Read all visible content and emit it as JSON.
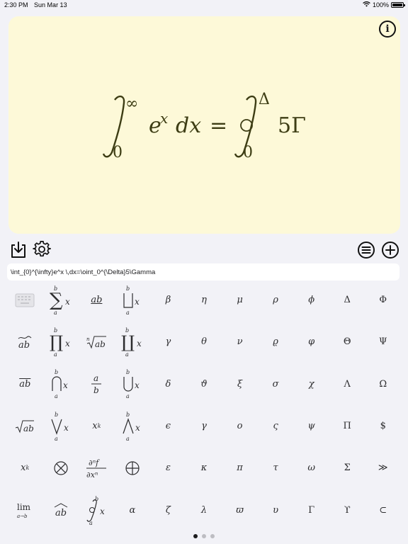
{
  "status_bar": {
    "time": "2:30 PM",
    "date": "Sun Mar 13",
    "battery": "100%"
  },
  "preview": {
    "info_glyph": "i",
    "formula": {
      "lower1": "0",
      "upper1": "∞",
      "body1": "e",
      "body1_exp": "x",
      "dx": "dx",
      "equals": "=",
      "lower2": "0",
      "upper2": "Δ",
      "rhs": "5Γ"
    }
  },
  "toolbar": {
    "icons": [
      "download-icon",
      "gear-icon",
      "list-icon",
      "add-icon"
    ]
  },
  "latex_input": {
    "value": "\\int_{0}^{\\infty}e^x \\,dx=\\oint_0^{\\Delta}5\\Gamma"
  },
  "keys": {
    "r1": [
      "keyboard-icon",
      "sum",
      "ab-underline",
      "coproduct",
      "β",
      "η",
      "μ",
      "ρ",
      "ϕ",
      "Δ",
      "Φ"
    ],
    "r2": [
      "ab-tilde",
      "product",
      "nth-root",
      "coproduct-big",
      "γ",
      "θ",
      "ν",
      "ϱ",
      "φ",
      "Θ",
      "Ψ"
    ],
    "r3": [
      "ab-overline",
      "bigcap",
      "fraction",
      "bigcup",
      "δ",
      "ϑ",
      "ξ",
      "σ",
      "χ",
      "Λ",
      "Ω"
    ],
    "r4": [
      "sqrt",
      "bigvee",
      "subscript",
      "bigwedge",
      "ϵ",
      "γ",
      "o",
      "ς",
      "ψ",
      "Π",
      "$"
    ],
    "r5": [
      "superscript",
      "otimes",
      "partial",
      "oplus",
      "ε",
      "κ",
      "π",
      "τ",
      "ω",
      "Σ",
      "≫"
    ],
    "r6": [
      "limit",
      "ab-hat",
      "oint",
      "α",
      "ζ",
      "λ",
      "ϖ",
      "υ",
      "Γ",
      "ϒ",
      "⊂"
    ]
  },
  "key_text": {
    "a": "a",
    "b": "b",
    "x": "x",
    "ab": "ab",
    "n": "n",
    "k": "k",
    "lim": "lim",
    "lim_sub": "a→b",
    "d_num": "∂ⁿf",
    "d_den": "∂xⁿ"
  },
  "pager": {
    "pages": 3,
    "active": 0
  }
}
